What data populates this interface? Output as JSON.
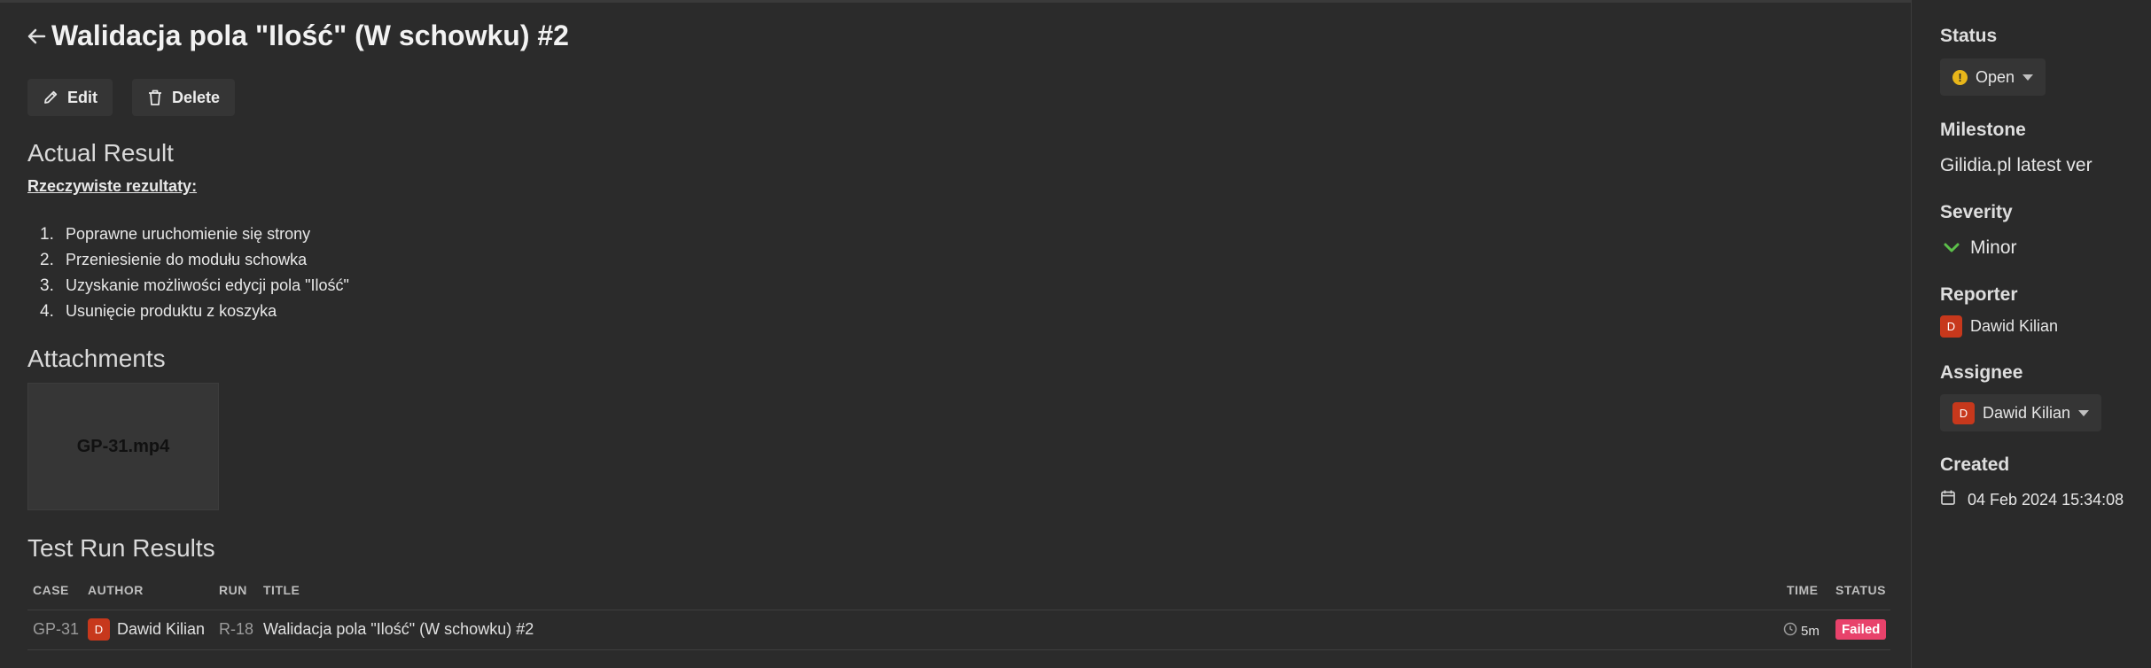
{
  "issue": {
    "title": "Walidacja pola \"Ilość\" (W schowku) #2"
  },
  "actions": {
    "edit_label": "Edit",
    "delete_label": "Delete"
  },
  "actual_result": {
    "heading": "Actual Result",
    "subheading": "Rzeczywiste rezultaty:",
    "steps": [
      {
        "num": "1.",
        "text": "Poprawne uruchomienie się strony"
      },
      {
        "num": "2.",
        "text": "Przeniesienie do modułu schowka"
      },
      {
        "num": "3.",
        "text": "Uzyskanie możliwości edycji pola \"Ilość\""
      },
      {
        "num": "4.",
        "text": "Usunięcie produktu z koszyka"
      }
    ]
  },
  "attachments": {
    "heading": "Attachments",
    "files": [
      {
        "name": "GP-31.mp4"
      }
    ]
  },
  "test_runs": {
    "heading": "Test Run Results",
    "columns": {
      "case": "CASE",
      "author": "AUTHOR",
      "run": "RUN",
      "title": "TITLE",
      "time": "TIME",
      "status": "STATUS"
    },
    "rows": [
      {
        "case": "GP-31",
        "author_initial": "D",
        "author": "Dawid Kilian",
        "run": "R-18",
        "title": "Walidacja pola \"Ilość\" (W schowku) #2",
        "time": "5m",
        "status": "Failed"
      }
    ]
  },
  "sidebar": {
    "status_label": "Status",
    "status_value": "Open",
    "milestone_label": "Milestone",
    "milestone_value": "Gilidia.pl latest ver",
    "severity_label": "Severity",
    "severity_value": "Minor",
    "reporter_label": "Reporter",
    "reporter_initial": "D",
    "reporter_name": "Dawid Kilian",
    "assignee_label": "Assignee",
    "assignee_initial": "D",
    "assignee_name": "Dawid Kilian",
    "created_label": "Created",
    "created_value": "04 Feb 2024 15:34:08"
  },
  "colors": {
    "background": "#2b2b2b",
    "avatar": "#c7381c",
    "failed_badge": "#e8426b",
    "open_status": "#e8b61a",
    "minor_severity": "#5cc04a"
  }
}
